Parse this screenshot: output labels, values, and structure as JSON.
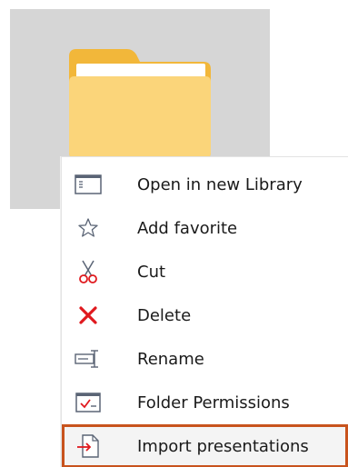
{
  "folder": {
    "icon": "folder-icon",
    "colors": {
      "tile_background": "#d6d6d6",
      "folder_body": "#fbd57a",
      "folder_back": "#f2b73a",
      "paper": "#ffffff"
    }
  },
  "context_menu": {
    "items": [
      {
        "label": "Open in new Library",
        "icon": "open-library-icon"
      },
      {
        "label": "Add favorite",
        "icon": "star-outline-icon"
      },
      {
        "label": "Cut",
        "icon": "scissors-icon"
      },
      {
        "label": "Delete",
        "icon": "delete-x-icon"
      },
      {
        "label": "Rename",
        "icon": "rename-icon"
      },
      {
        "label": "Folder Permissions",
        "icon": "folder-permissions-icon"
      },
      {
        "label": "Import presentations",
        "icon": "import-icon",
        "highlighted": true
      }
    ],
    "highlight_color": "#c8531d",
    "delete_color": "#e0191e"
  }
}
